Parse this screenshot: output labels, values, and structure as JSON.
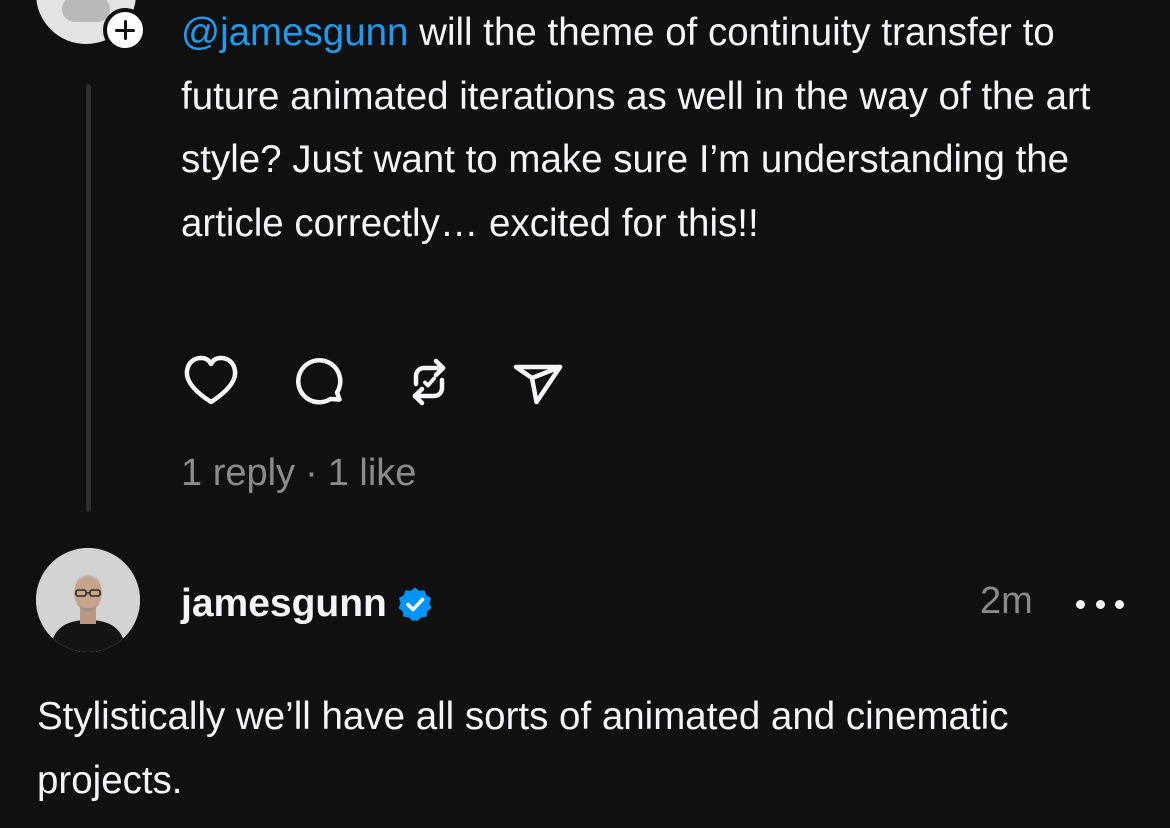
{
  "parent_post": {
    "mention": "@jamesgunn",
    "text": " will the theme of continuity transfer to future animated iterations as well in the way of the art style? Just want to make sure I’m understanding the article correctly… excited for this!!",
    "actions": [
      {
        "icon": "heart-icon"
      },
      {
        "icon": "comment-icon"
      },
      {
        "icon": "repost-icon"
      },
      {
        "icon": "share-icon"
      }
    ],
    "replies": "1 reply",
    "separator": "·",
    "likes": "1 like"
  },
  "reply": {
    "username": "jamesgunn",
    "verified_icon": "verified-badge-icon",
    "timestamp": "2m",
    "more_icon": "more-options-icon",
    "text": "Stylistically we’ll have all sorts of animated and cinematic projects."
  },
  "colors": {
    "background": "#101010",
    "text": "#f3f5f7",
    "muted": "#8b8b8b",
    "mention": "#1d9bf0",
    "verified": "#0095f6"
  }
}
